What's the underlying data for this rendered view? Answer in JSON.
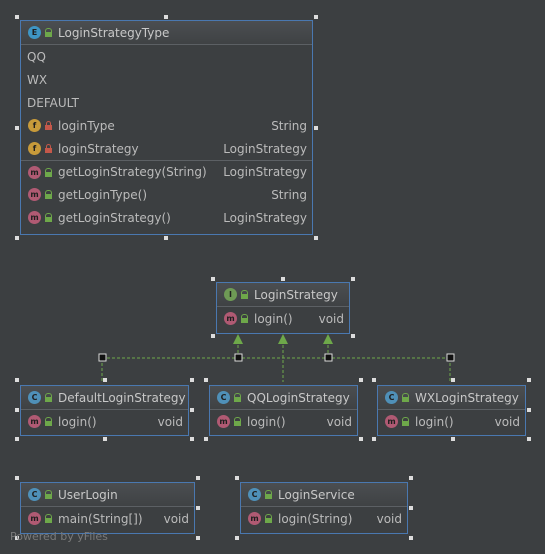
{
  "classes": {
    "login_strategy_type": {
      "title": "LoginStrategyType",
      "constants": [
        "QQ",
        "WX",
        "DEFAULT"
      ],
      "fields": [
        {
          "name": "loginType",
          "type": "String"
        },
        {
          "name": "loginStrategy",
          "type": "LoginStrategy"
        }
      ],
      "methods": [
        {
          "name": "getLoginStrategy(String)",
          "type": "LoginStrategy"
        },
        {
          "name": "getLoginType()",
          "type": "String"
        },
        {
          "name": "getLoginStrategy()",
          "type": "LoginStrategy"
        }
      ]
    },
    "login_strategy": {
      "title": "LoginStrategy",
      "method": {
        "name": "login()",
        "type": "void"
      }
    },
    "default_login_strategy": {
      "title": "DefaultLoginStrategy",
      "method": {
        "name": "login()",
        "type": "void"
      }
    },
    "qq_login_strategy": {
      "title": "QQLoginStrategy",
      "method": {
        "name": "login()",
        "type": "void"
      }
    },
    "wx_login_strategy": {
      "title": "WXLoginStrategy",
      "method": {
        "name": "login()",
        "type": "void"
      }
    },
    "user_login": {
      "title": "UserLogin",
      "method": {
        "name": "main(String[])",
        "type": "void"
      }
    },
    "login_service": {
      "title": "LoginService",
      "method": {
        "name": "login(String)",
        "type": "void"
      }
    }
  },
  "icons": {
    "enum": "E",
    "class": "C",
    "interface": "I",
    "field": "f",
    "method": "m"
  },
  "watermark": "Powered by yFiles",
  "colors": {
    "background": "#3c3f41",
    "border": "#4a78b0",
    "arrow": "#6ea84a",
    "method_icon": "#b05a73",
    "field_icon": "#c79a3a",
    "class_icon": "#4f90b8",
    "interface_icon": "#6e9a55"
  }
}
